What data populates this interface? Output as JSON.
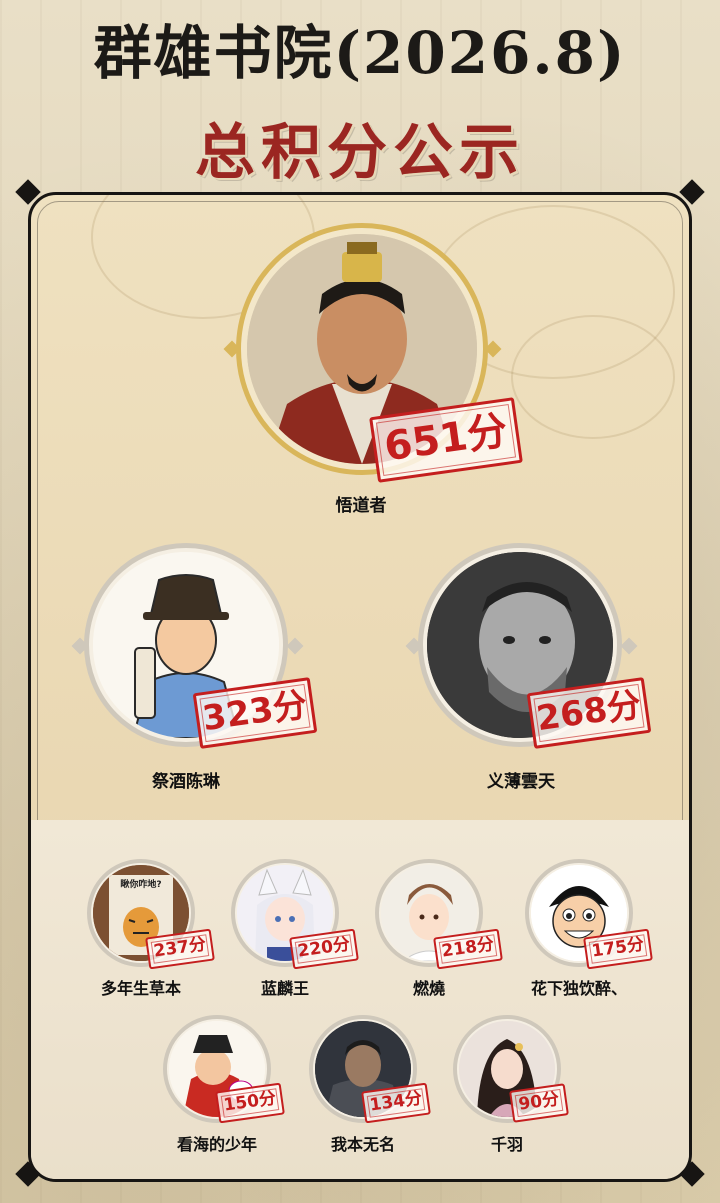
{
  "header": {
    "title": "群雄书院(2026.8)",
    "subtitle": "总积分公示"
  },
  "colors": {
    "title": "#1c1a17",
    "subtitle": "#9b2621",
    "stamp": "#c41e1e",
    "gold_ring": "#d9b65a"
  },
  "players": [
    {
      "rank": 1,
      "name": "悟道者",
      "score": "651分",
      "avatar": "official-portrait-avatar"
    },
    {
      "rank": 2,
      "name": "祭酒陈琳",
      "score": "323分",
      "avatar": "cartoon-scholar-avatar"
    },
    {
      "rank": 3,
      "name": "义薄雲天",
      "score": "268分",
      "avatar": "bw-photo-avatar"
    },
    {
      "rank": 4,
      "name": "多年生草本",
      "score": "237分",
      "avatar": "tiger-book-avatar",
      "avatar_text": "瞅你咋地?"
    },
    {
      "rank": 5,
      "name": "蓝麟王",
      "score": "220分",
      "avatar": "fox-girl-avatar"
    },
    {
      "rank": 6,
      "name": "燃燒",
      "score": "218分",
      "avatar": "anime-boy-avatar"
    },
    {
      "rank": 7,
      "name": "花下独饮醉、",
      "score": "175分",
      "avatar": "straw-hat-boy-avatar"
    },
    {
      "rank": 8,
      "name": "看海的少年",
      "score": "150分",
      "avatar": "red-official-cartoon-avatar"
    },
    {
      "rank": 9,
      "name": "我本无名",
      "score": "134分",
      "avatar": "game-soldier-avatar"
    },
    {
      "rank": 10,
      "name": "千羽",
      "score": "90分",
      "avatar": "ancient-lady-avatar"
    }
  ]
}
